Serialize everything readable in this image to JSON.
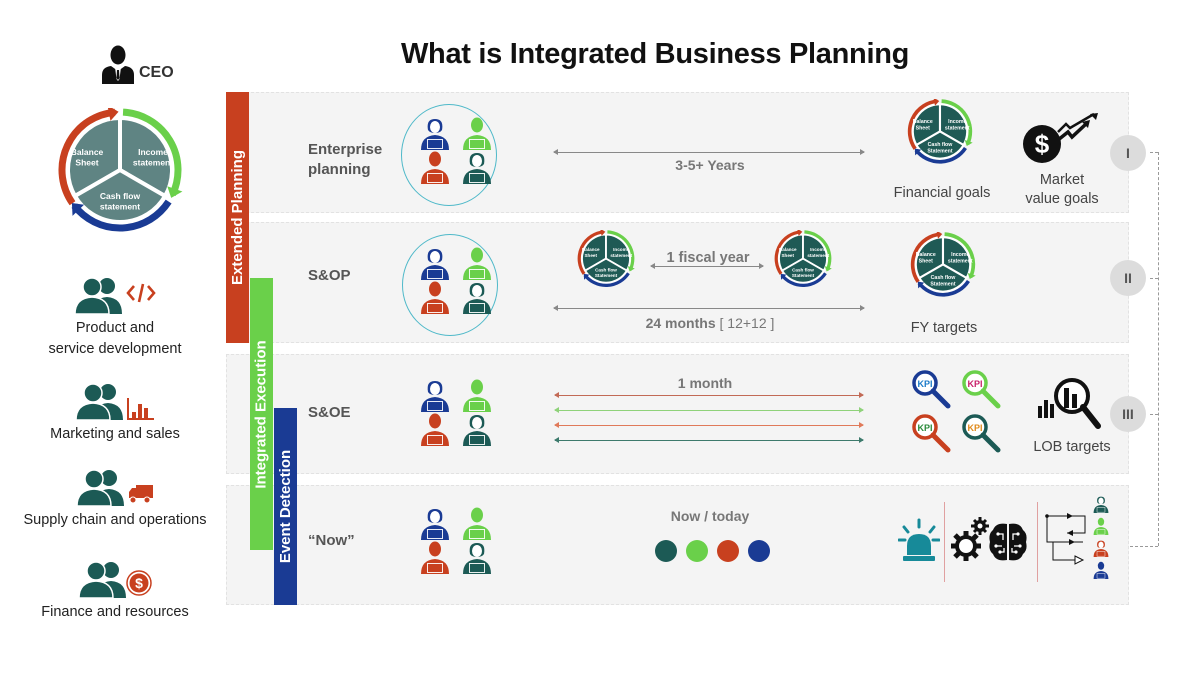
{
  "title": "What is Integrated Business Planning",
  "colors": {
    "teal_dark": "#1c5a55",
    "green": "#6ad04a",
    "red": "#c8401f",
    "blue": "#1a3b94",
    "pie_fill": "#1f5a55",
    "big_pie_fill": "#5f8483",
    "panel_bg": "#f4f4f4",
    "text_grey": "#777777"
  },
  "left_column": {
    "ceo_label": "CEO",
    "big_pie": {
      "segments": [
        "Balance Sheet",
        "Income statement",
        "Cash flow statement"
      ]
    },
    "departments": [
      {
        "label_line1": "Product and",
        "label_line2": "service development",
        "icon": "code-icon"
      },
      {
        "label_line1": "Marketing and sales",
        "label_line2": "",
        "icon": "bar-chart-icon"
      },
      {
        "label_line1": "Supply chain and operations",
        "label_line2": "",
        "icon": "truck-icon"
      },
      {
        "label_line1": "Finance and resources",
        "label_line2": "",
        "icon": "dollar-coin-icon"
      }
    ]
  },
  "bars": {
    "extended_planning": "Extended Planning",
    "integrated_execution": "Integrated Execution",
    "event_detection": "Event Detection"
  },
  "rows": [
    {
      "label_line1": "Enterprise",
      "label_line2": "planning",
      "horizon": "3-5+ Years",
      "goals": [
        "Financial goals",
        "Market value goals"
      ],
      "market_line1": "Market",
      "market_line2": "value goals",
      "roman": "I"
    },
    {
      "label_line1": "S&OP",
      "fiscal_label": "1 fiscal year",
      "horizon_bold": "24 months",
      "horizon_note": "[ 12+12 ]",
      "goal": "FY targets",
      "roman": "II"
    },
    {
      "label_line1": "S&OE",
      "horizon": "1 month",
      "kpi_label": "KPI",
      "goal": "LOB targets",
      "roman": "III"
    },
    {
      "label_line1": "“Now”",
      "horizon": "Now / today"
    }
  ],
  "small_pie": {
    "segments": [
      "Balance Sheet",
      "Income statement",
      "Cash flow Statement"
    ]
  }
}
